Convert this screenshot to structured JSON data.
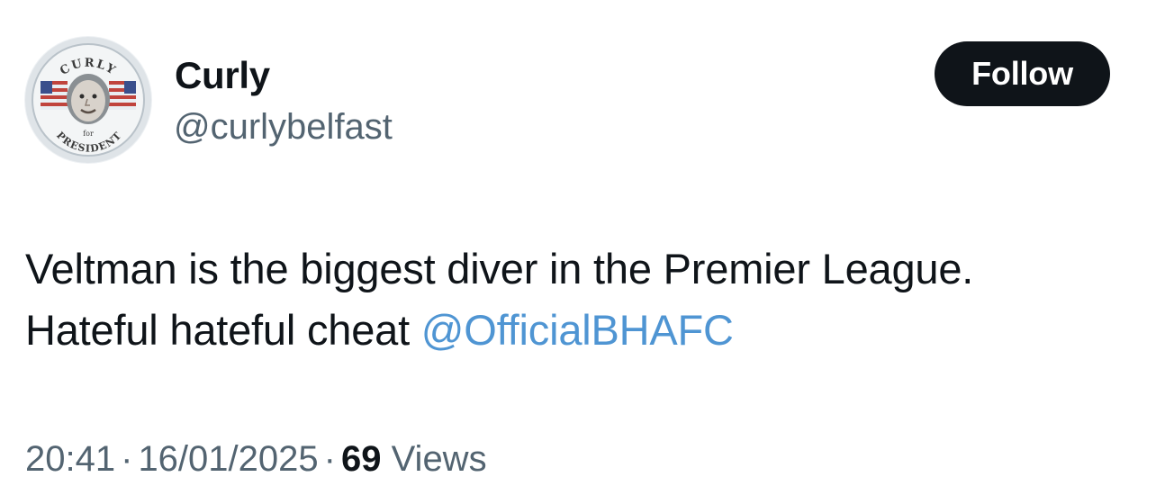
{
  "author": {
    "display_name": "Curly",
    "handle": "@curlybelfast",
    "avatar_icon": "curly-for-president-badge-avatar",
    "avatar_text_top": "CURLY",
    "avatar_text_middle": "for",
    "avatar_text_bottom": "PRESIDENT"
  },
  "follow_button": {
    "label": "Follow"
  },
  "tweet": {
    "line1": "Veltman is the biggest diver in the Premier League.",
    "line2_text": "Hateful hateful cheat ",
    "mention": "@OfficialBHAFC"
  },
  "meta": {
    "time": "20:41",
    "separator": "·",
    "date": "16/01/2025",
    "views_count": "69",
    "views_label": "Views"
  },
  "colors": {
    "text": "#0f1419",
    "secondary": "#536471",
    "mention": "#4f95d3",
    "button_bg": "#0f1419",
    "button_text": "#ffffff"
  }
}
